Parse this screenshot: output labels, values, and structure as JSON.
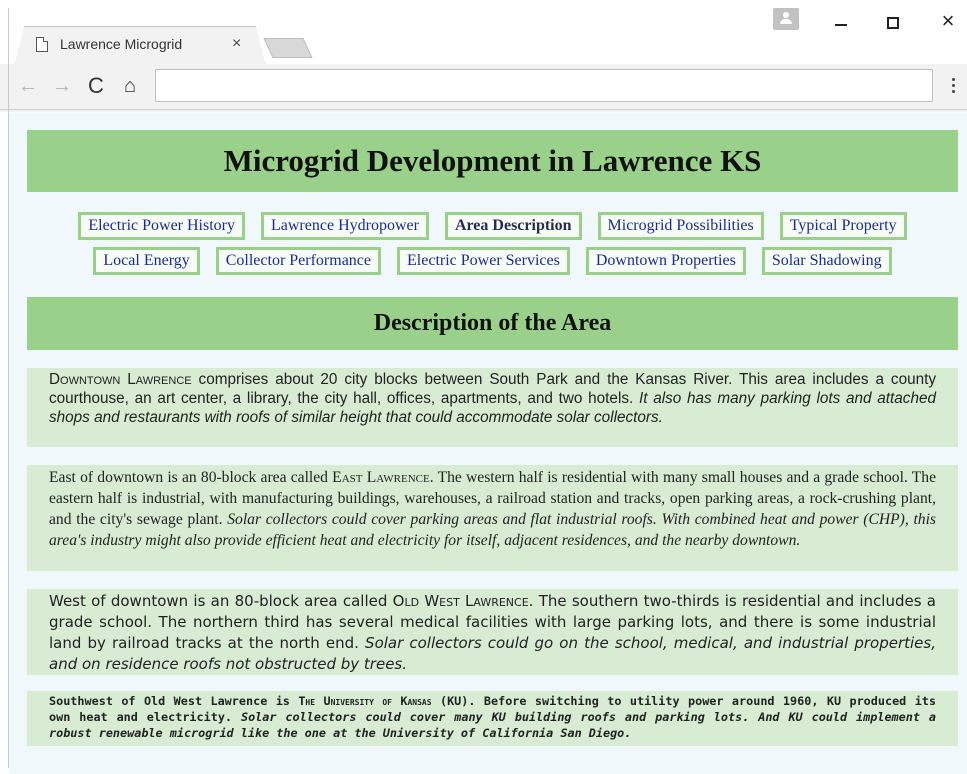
{
  "browser": {
    "tab_title": "Lawrence Microgrid",
    "tab_close": "×",
    "address": "",
    "back": "←",
    "forward": "→",
    "reload": "C",
    "home": "⌂",
    "close_window": "×"
  },
  "page": {
    "title": "Microgrid Development in Lawrence KS",
    "nav_row1": [
      {
        "label": "Electric Power History"
      },
      {
        "label": "Lawrence Hydropower"
      },
      {
        "label": "Area Description"
      },
      {
        "label": "Microgrid Possibilities"
      },
      {
        "label": "Typical Property"
      }
    ],
    "nav_row2": [
      {
        "label": "Local Energy"
      },
      {
        "label": "Collector Performance"
      },
      {
        "label": "Electric Power Services"
      },
      {
        "label": "Downtown Properties"
      },
      {
        "label": "Solar Shadowing"
      }
    ],
    "active_nav": "Area Description",
    "section_heading": "Description of the Area",
    "paragraphs": [
      {
        "name_sc": "Downtown Lawrence",
        "text": " comprises about 20 city blocks between South Park and the Kansas River. This area includes a county courthouse, an art center, a library, the city hall, offices, apartments, and two hotels. ",
        "italic": "It also has many parking lots and attached shops and restaurants with roofs of similar height that could accommodate solar collectors."
      },
      {
        "lead": "East of downtown is an 80-block area called ",
        "name_sc": "East Lawrence",
        "text": ". The western half is residential with many small houses and a grade school. The eastern half is industrial, with manufacturing buildings, warehouses, a railroad station and tracks, open parking areas, a rock-crushing plant, and the city's sewage plant. ",
        "italic": "Solar collectors could cover parking areas and flat industrial roofs. With combined heat and power (CHP), this area's industry might also provide efficient heat and electricity for itself, adjacent residences, and the nearby downtown."
      },
      {
        "lead": "West of downtown is an 80-block area called ",
        "name_sc": "Old West Lawrence",
        "text": ". The southern two-thirds is residential and includes a grade school. The northern third has several medical facilities with large parking lots, and there is some industrial land by railroad tracks at the north end. ",
        "italic": "Solar collectors could go on the school, medical, and industrial properties, and on residence roofs not obstructed by trees."
      },
      {
        "lead": "Southwest of Old West Lawrence is ",
        "name_sc": "The University of Kansas",
        "text": " (KU). Before switching to utility power around 1960, KU produced its own heat and electricity. ",
        "italic": "Solar collectors could cover many KU building roofs and parking lots. And KU could implement a robust renewable microgrid like the one at the University of California San Diego."
      }
    ]
  },
  "colors": {
    "banner_green": "#99d18a",
    "paragraph_bg": "#d7ecd3",
    "page_bg": "#f1f8fb",
    "link_blue": "#1a2a9a"
  }
}
